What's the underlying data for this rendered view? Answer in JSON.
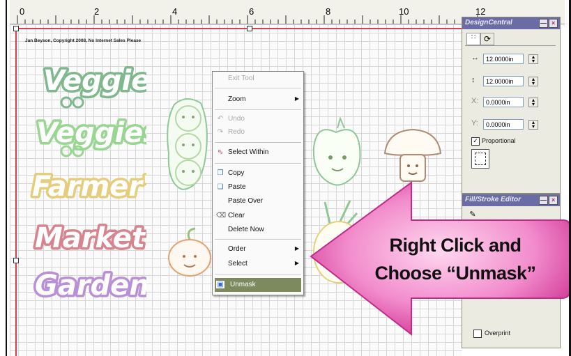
{
  "ruler": {
    "numbers": [
      "0",
      "2",
      "4",
      "6",
      "8",
      "10",
      "12"
    ]
  },
  "canvas": {
    "copyright": "Jan Beyson, Copyright 2008, No Internet Sales Please",
    "words": [
      "Veggie",
      "Veggies",
      "Farmer's",
      "Market",
      "Garden"
    ],
    "word_colors": [
      "#8fc89a",
      "#a8e0a0",
      "#f0d88a",
      "#e0909a",
      "#c8a0e0"
    ]
  },
  "context_menu": {
    "items": [
      {
        "label": "Exit Tool",
        "disabled": true
      },
      {
        "label": "Zoom",
        "submenu": true
      },
      {
        "label": "Undo",
        "disabled": true,
        "icon": "undo-icon"
      },
      {
        "label": "Redo",
        "disabled": true,
        "icon": "redo-icon"
      },
      {
        "label": "Select Within",
        "icon": "select-within-icon"
      },
      {
        "label": "Copy",
        "icon": "copy-icon"
      },
      {
        "label": "Paste",
        "icon": "paste-icon"
      },
      {
        "label": "Paste Over"
      },
      {
        "label": "Clear",
        "icon": "clear-icon"
      },
      {
        "label": "Delete Now"
      },
      {
        "label": "Order",
        "submenu": true
      },
      {
        "label": "Select",
        "submenu": true
      },
      {
        "label": "Unmask",
        "icon": "unmask-icon",
        "highlighted": true
      }
    ]
  },
  "design_central": {
    "title": "DesignCentral",
    "width": "12.0000in",
    "height": "12.0000in",
    "x": "0.0000in",
    "y": "0.0000in",
    "proportional_label": "Proportional",
    "proportional_checked": true,
    "x_label": "X:",
    "y_label": "Y:"
  },
  "fill_stroke": {
    "title": "Fill/Stroke Editor",
    "overprint_label": "Overprint"
  },
  "callout": {
    "line1": "Right Click and",
    "line2": "Choose “Unmask”",
    "color": "#e0409a"
  }
}
